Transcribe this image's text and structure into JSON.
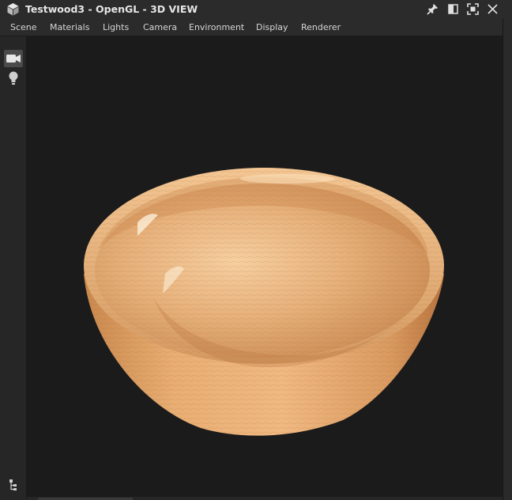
{
  "window": {
    "title": "Testwood3 - OpenGL - 3D VIEW",
    "icons": [
      "cube-icon",
      "pin-icon",
      "restore-icon",
      "maximize-icon",
      "close-icon"
    ]
  },
  "menu": {
    "items": [
      {
        "label": "Scene"
      },
      {
        "label": "Materials"
      },
      {
        "label": "Lights"
      },
      {
        "label": "Camera"
      },
      {
        "label": "Environment"
      },
      {
        "label": "Display"
      },
      {
        "label": "Renderer"
      }
    ]
  },
  "toolbar": {
    "tools": [
      "camera-icon",
      "light-bulb-icon"
    ],
    "bottom_tool": "hierarchy-icon"
  },
  "viewport": {
    "object": "wooden bowl",
    "background": "#1b1b1b"
  },
  "colors": {
    "chrome": "#2b2b2b",
    "text": "#d6d6d6",
    "wood_light": "#f2c08a",
    "wood_dark": "#b8733e"
  }
}
